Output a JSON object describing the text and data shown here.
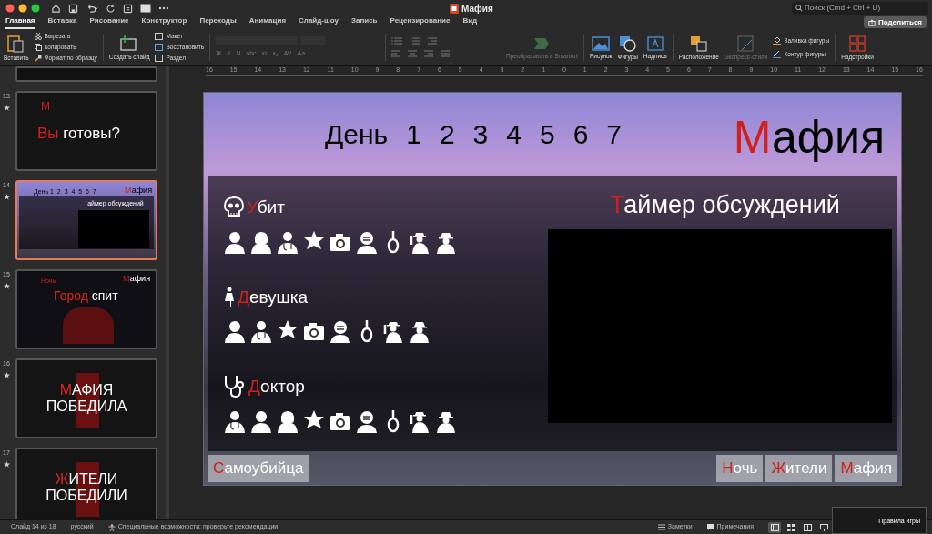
{
  "window": {
    "title": "Мафия",
    "search_placeholder": "Поиск (Cmd + Ctrl + U)",
    "share_button": "Поделиться"
  },
  "tabs": [
    {
      "label": "Главная",
      "selected": true
    },
    {
      "label": "Вставка",
      "selected": false
    },
    {
      "label": "Рисование",
      "selected": false
    },
    {
      "label": "Конструктор",
      "selected": false
    },
    {
      "label": "Переходы",
      "selected": false
    },
    {
      "label": "Анимация",
      "selected": false
    },
    {
      "label": "Слайд-шоу",
      "selected": false
    },
    {
      "label": "Запись",
      "selected": false
    },
    {
      "label": "Рецензирование",
      "selected": false
    },
    {
      "label": "Вид",
      "selected": false
    }
  ],
  "ribbon": {
    "paste": "Вставить",
    "cut": "Вырезать",
    "copy": "Копировать",
    "format_painter": "Формат по образцу",
    "new_slide": "Создать слайд",
    "layout": "Макет",
    "reset": "Восстановить",
    "section": "Раздел",
    "format_buttons": [
      "Ж",
      "К",
      "Ч",
      "abc",
      "x²",
      "x₂",
      "AV",
      "Aa"
    ],
    "smartart": {
      "label": "Преобразовать в SmartArt",
      "disabled": true
    },
    "picture": "Рисунок",
    "shapes": "Фигуры",
    "text_box": "Надпись",
    "arrange": "Расположение",
    "quick_styles": {
      "label": "Экспресс-стили",
      "disabled": true
    },
    "shape_fill": "Заливка фигуры",
    "shape_outline": "Контур фигуры",
    "addins": "Надстройки"
  },
  "ruler": [
    "16",
    "15",
    "14",
    "13",
    "12",
    "11",
    "10",
    "9",
    "8",
    "7",
    "6",
    "5",
    "4",
    "3",
    "2",
    "1",
    "0",
    "1",
    "2",
    "3",
    "4",
    "5",
    "6",
    "7",
    "8",
    "9",
    "10",
    "11",
    "12",
    "13",
    "14",
    "15",
    "16"
  ],
  "slides_panel": [
    {
      "kind": "partial",
      "selected": false
    },
    {
      "kind": "question",
      "number": "13",
      "selected": false,
      "letter": "М",
      "accent": "Вы",
      "text": " готовы?"
    },
    {
      "kind": "mini",
      "number": "14",
      "selected": true,
      "days": "День 1  2  3  4  5  6  7",
      "logo_accent": "М",
      "logo": "афия",
      "timer_accent": "Т",
      "timer": "аймер обсуждений"
    },
    {
      "kind": "night",
      "number": "15",
      "selected": false,
      "label": "Ночь",
      "logo_accent": "М",
      "logo": "афия",
      "accent": "Город",
      "text": " спит"
    },
    {
      "kind": "poster",
      "number": "16",
      "selected": false,
      "accent": "М",
      "line1": "АФИЯ",
      "line2": "ПОБЕДИЛА"
    },
    {
      "kind": "poster",
      "number": "17",
      "selected": false,
      "accent": "Ж",
      "line1": "ИТЕЛИ",
      "line2": "ПОБЕДИЛИ"
    }
  ],
  "slide": {
    "days_label": "День",
    "days": [
      "1",
      "2",
      "3",
      "4",
      "5",
      "6",
      "7"
    ],
    "logo": {
      "accent": "М",
      "text": "афия"
    },
    "sections": [
      {
        "kind": "killed",
        "accent": "У",
        "text": "бит",
        "icons": [
          {
            "kind": "man"
          },
          {
            "kind": "woman"
          },
          {
            "kind": "doctor"
          },
          {
            "kind": "star"
          },
          {
            "kind": "camera"
          },
          {
            "kind": "masked"
          },
          {
            "kind": "noose"
          },
          {
            "kind": "gunman"
          },
          {
            "kind": "hat"
          }
        ]
      },
      {
        "kind": "girl",
        "accent": "Д",
        "text": "евушка",
        "icons": [
          {
            "kind": "man"
          },
          {
            "kind": "doctor"
          },
          {
            "kind": "star"
          },
          {
            "kind": "camera"
          },
          {
            "kind": "masked"
          },
          {
            "kind": "noose"
          },
          {
            "kind": "gunman"
          },
          {
            "kind": "hat"
          }
        ]
      },
      {
        "kind": "doctor",
        "accent": "Д",
        "text": "октор",
        "icons": [
          {
            "kind": "doctor"
          },
          {
            "kind": "man"
          },
          {
            "kind": "woman"
          },
          {
            "kind": "star"
          },
          {
            "kind": "camera"
          },
          {
            "kind": "masked"
          },
          {
            "kind": "noose"
          },
          {
            "kind": "gunman"
          },
          {
            "kind": "hat"
          }
        ]
      }
    ],
    "timer": {
      "accent": "Т",
      "text": "аймер обсуждений"
    },
    "left_buttons": [
      {
        "accent": "С",
        "text": "амоубийца"
      }
    ],
    "right_buttons": [
      {
        "accent": "Н",
        "text": "очь"
      },
      {
        "accent": "Ж",
        "text": "ители"
      },
      {
        "accent": "М",
        "text": "афия"
      }
    ]
  },
  "status_bar": {
    "slide_counter": "Слайд 14 из 18",
    "language": "русский",
    "accessibility": "Специальные возможности: проверьте рекомендации",
    "notes": "Заметки",
    "comments": "Примечания",
    "views": [
      {
        "kind": "normal",
        "selected": true
      },
      {
        "kind": "sorter",
        "selected": false
      },
      {
        "kind": "reading",
        "selected": false
      },
      {
        "kind": "show",
        "selected": false
      }
    ],
    "preview_title": "Правила игры"
  }
}
